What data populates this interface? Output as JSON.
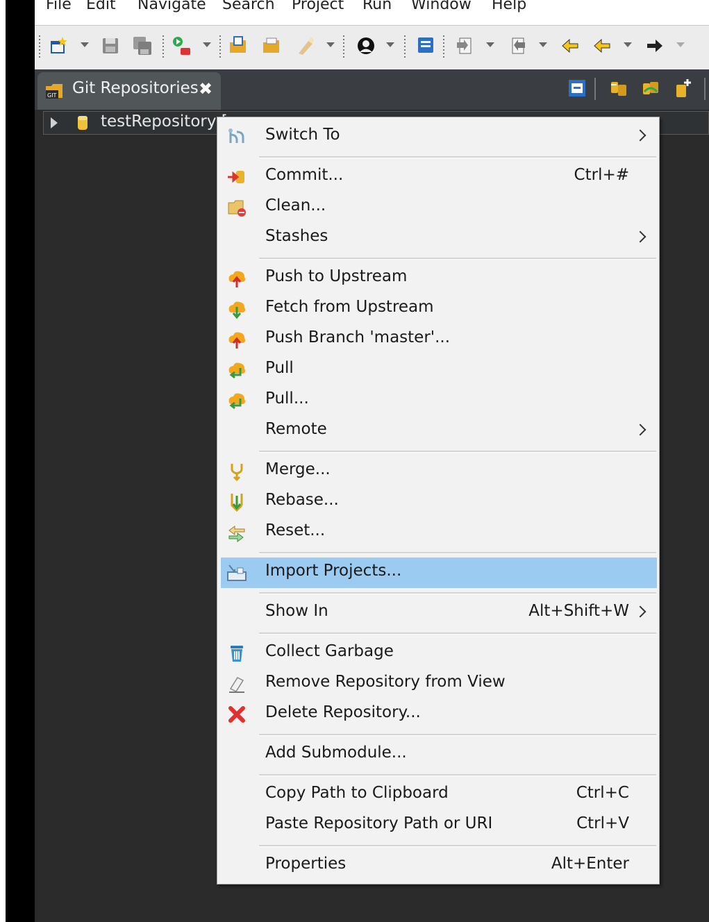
{
  "menubar": {
    "items": [
      "File",
      "Edit",
      "Navigate",
      "Search",
      "Project",
      "Run",
      "Window",
      "Help"
    ]
  },
  "view": {
    "tab_label": "Git Repositories",
    "close_glyph": "✖"
  },
  "tree": {
    "repo_label": "testRepository ["
  },
  "context_menu": {
    "items": [
      {
        "label": "Switch To",
        "shortcut": "",
        "icon": "switch-branch-icon"
      },
      {
        "label": "Commit...",
        "shortcut": "Ctrl+#",
        "icon": "commit-icon"
      },
      {
        "label": "Clean...",
        "shortcut": "",
        "icon": "clean-icon"
      },
      {
        "label": "Stashes",
        "shortcut": "",
        "icon": ""
      },
      {
        "label": "Push to Upstream",
        "shortcut": "",
        "icon": "push-icon"
      },
      {
        "label": "Fetch from Upstream",
        "shortcut": "",
        "icon": "fetch-icon"
      },
      {
        "label": "Push Branch 'master'...",
        "shortcut": "",
        "icon": "push-branch-icon"
      },
      {
        "label": "Pull",
        "shortcut": "",
        "icon": "pull-icon"
      },
      {
        "label": "Pull...",
        "shortcut": "",
        "icon": "pull-dialog-icon"
      },
      {
        "label": "Remote",
        "shortcut": "",
        "icon": ""
      },
      {
        "label": "Merge...",
        "shortcut": "",
        "icon": "merge-icon"
      },
      {
        "label": "Rebase...",
        "shortcut": "",
        "icon": "rebase-icon"
      },
      {
        "label": "Reset...",
        "shortcut": "",
        "icon": "reset-icon"
      },
      {
        "label": "Import Projects...",
        "shortcut": "",
        "icon": "import-projects-icon",
        "highlighted": true
      },
      {
        "label": "Show In",
        "shortcut": "Alt+Shift+W",
        "icon": ""
      },
      {
        "label": "Collect Garbage",
        "shortcut": "",
        "icon": "trash-icon"
      },
      {
        "label": "Remove Repository from View",
        "shortcut": "",
        "icon": "eraser-icon"
      },
      {
        "label": "Delete Repository...",
        "shortcut": "",
        "icon": "delete-icon"
      },
      {
        "label": "Add Submodule...",
        "shortcut": "",
        "icon": ""
      },
      {
        "label": "Copy Path to Clipboard",
        "shortcut": "Ctrl+C",
        "icon": ""
      },
      {
        "label": "Paste Repository Path or URI",
        "shortcut": "Ctrl+V",
        "icon": ""
      },
      {
        "label": "Properties",
        "shortcut": "Alt+Enter",
        "icon": ""
      }
    ]
  },
  "colors": {
    "highlight": "#9ccbf1",
    "menu_bg": "#f2f2f2",
    "dark_bg": "#2b2b2b"
  }
}
